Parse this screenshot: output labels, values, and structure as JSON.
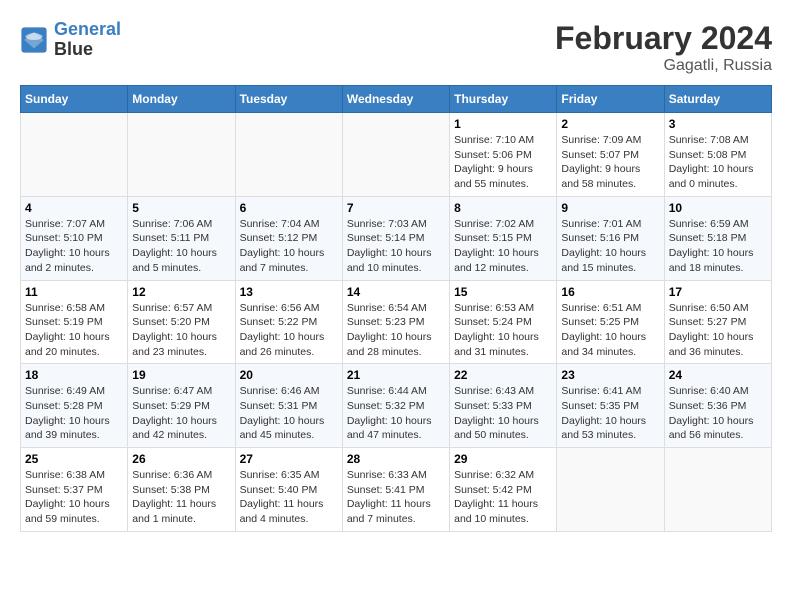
{
  "header": {
    "logo_line1": "General",
    "logo_line2": "Blue",
    "title": "February 2024",
    "subtitle": "Gagatli, Russia"
  },
  "days_of_week": [
    "Sunday",
    "Monday",
    "Tuesday",
    "Wednesday",
    "Thursday",
    "Friday",
    "Saturday"
  ],
  "weeks": [
    [
      {
        "day": "",
        "info": ""
      },
      {
        "day": "",
        "info": ""
      },
      {
        "day": "",
        "info": ""
      },
      {
        "day": "",
        "info": ""
      },
      {
        "day": "1",
        "info": "Sunrise: 7:10 AM\nSunset: 5:06 PM\nDaylight: 9 hours\nand 55 minutes."
      },
      {
        "day": "2",
        "info": "Sunrise: 7:09 AM\nSunset: 5:07 PM\nDaylight: 9 hours\nand 58 minutes."
      },
      {
        "day": "3",
        "info": "Sunrise: 7:08 AM\nSunset: 5:08 PM\nDaylight: 10 hours\nand 0 minutes."
      }
    ],
    [
      {
        "day": "4",
        "info": "Sunrise: 7:07 AM\nSunset: 5:10 PM\nDaylight: 10 hours\nand 2 minutes."
      },
      {
        "day": "5",
        "info": "Sunrise: 7:06 AM\nSunset: 5:11 PM\nDaylight: 10 hours\nand 5 minutes."
      },
      {
        "day": "6",
        "info": "Sunrise: 7:04 AM\nSunset: 5:12 PM\nDaylight: 10 hours\nand 7 minutes."
      },
      {
        "day": "7",
        "info": "Sunrise: 7:03 AM\nSunset: 5:14 PM\nDaylight: 10 hours\nand 10 minutes."
      },
      {
        "day": "8",
        "info": "Sunrise: 7:02 AM\nSunset: 5:15 PM\nDaylight: 10 hours\nand 12 minutes."
      },
      {
        "day": "9",
        "info": "Sunrise: 7:01 AM\nSunset: 5:16 PM\nDaylight: 10 hours\nand 15 minutes."
      },
      {
        "day": "10",
        "info": "Sunrise: 6:59 AM\nSunset: 5:18 PM\nDaylight: 10 hours\nand 18 minutes."
      }
    ],
    [
      {
        "day": "11",
        "info": "Sunrise: 6:58 AM\nSunset: 5:19 PM\nDaylight: 10 hours\nand 20 minutes."
      },
      {
        "day": "12",
        "info": "Sunrise: 6:57 AM\nSunset: 5:20 PM\nDaylight: 10 hours\nand 23 minutes."
      },
      {
        "day": "13",
        "info": "Sunrise: 6:56 AM\nSunset: 5:22 PM\nDaylight: 10 hours\nand 26 minutes."
      },
      {
        "day": "14",
        "info": "Sunrise: 6:54 AM\nSunset: 5:23 PM\nDaylight: 10 hours\nand 28 minutes."
      },
      {
        "day": "15",
        "info": "Sunrise: 6:53 AM\nSunset: 5:24 PM\nDaylight: 10 hours\nand 31 minutes."
      },
      {
        "day": "16",
        "info": "Sunrise: 6:51 AM\nSunset: 5:25 PM\nDaylight: 10 hours\nand 34 minutes."
      },
      {
        "day": "17",
        "info": "Sunrise: 6:50 AM\nSunset: 5:27 PM\nDaylight: 10 hours\nand 36 minutes."
      }
    ],
    [
      {
        "day": "18",
        "info": "Sunrise: 6:49 AM\nSunset: 5:28 PM\nDaylight: 10 hours\nand 39 minutes."
      },
      {
        "day": "19",
        "info": "Sunrise: 6:47 AM\nSunset: 5:29 PM\nDaylight: 10 hours\nand 42 minutes."
      },
      {
        "day": "20",
        "info": "Sunrise: 6:46 AM\nSunset: 5:31 PM\nDaylight: 10 hours\nand 45 minutes."
      },
      {
        "day": "21",
        "info": "Sunrise: 6:44 AM\nSunset: 5:32 PM\nDaylight: 10 hours\nand 47 minutes."
      },
      {
        "day": "22",
        "info": "Sunrise: 6:43 AM\nSunset: 5:33 PM\nDaylight: 10 hours\nand 50 minutes."
      },
      {
        "day": "23",
        "info": "Sunrise: 6:41 AM\nSunset: 5:35 PM\nDaylight: 10 hours\nand 53 minutes."
      },
      {
        "day": "24",
        "info": "Sunrise: 6:40 AM\nSunset: 5:36 PM\nDaylight: 10 hours\nand 56 minutes."
      }
    ],
    [
      {
        "day": "25",
        "info": "Sunrise: 6:38 AM\nSunset: 5:37 PM\nDaylight: 10 hours\nand 59 minutes."
      },
      {
        "day": "26",
        "info": "Sunrise: 6:36 AM\nSunset: 5:38 PM\nDaylight: 11 hours\nand 1 minute."
      },
      {
        "day": "27",
        "info": "Sunrise: 6:35 AM\nSunset: 5:40 PM\nDaylight: 11 hours\nand 4 minutes."
      },
      {
        "day": "28",
        "info": "Sunrise: 6:33 AM\nSunset: 5:41 PM\nDaylight: 11 hours\nand 7 minutes."
      },
      {
        "day": "29",
        "info": "Sunrise: 6:32 AM\nSunset: 5:42 PM\nDaylight: 11 hours\nand 10 minutes."
      },
      {
        "day": "",
        "info": ""
      },
      {
        "day": "",
        "info": ""
      }
    ]
  ]
}
